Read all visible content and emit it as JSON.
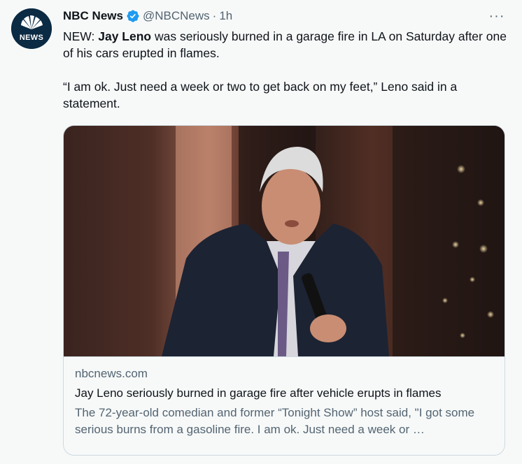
{
  "tweet": {
    "author_name": "NBC News",
    "author_handle": "@NBCNews",
    "separator": "·",
    "time": "1h",
    "avatar_text": "NEWS",
    "more_label": "···",
    "text_prefix": "NEW: ",
    "text_bold": "Jay Leno",
    "text_rest": " was seriously burned in a garage fire in LA on Saturday after one of his cars erupted in flames.",
    "text_quote": "“I am ok. Just need a week or two to get back on my feet,” Leno said in a statement."
  },
  "card": {
    "domain": "nbcnews.com",
    "title": "Jay Leno seriously burned in garage fire after vehicle erupts in flames",
    "description": "The 72-year-old comedian and former “Tonight Show” host said, \"I got some serious burns from a gasoline fire. I am ok. Just need a week or …",
    "image_icon": "photo-of-jay-leno-with-microphone"
  },
  "colors": {
    "verified": "#1d9bf0",
    "text": "#0f1419",
    "secondary": "#536471",
    "border": "#cfd9de",
    "background": "#f7f9f9"
  }
}
